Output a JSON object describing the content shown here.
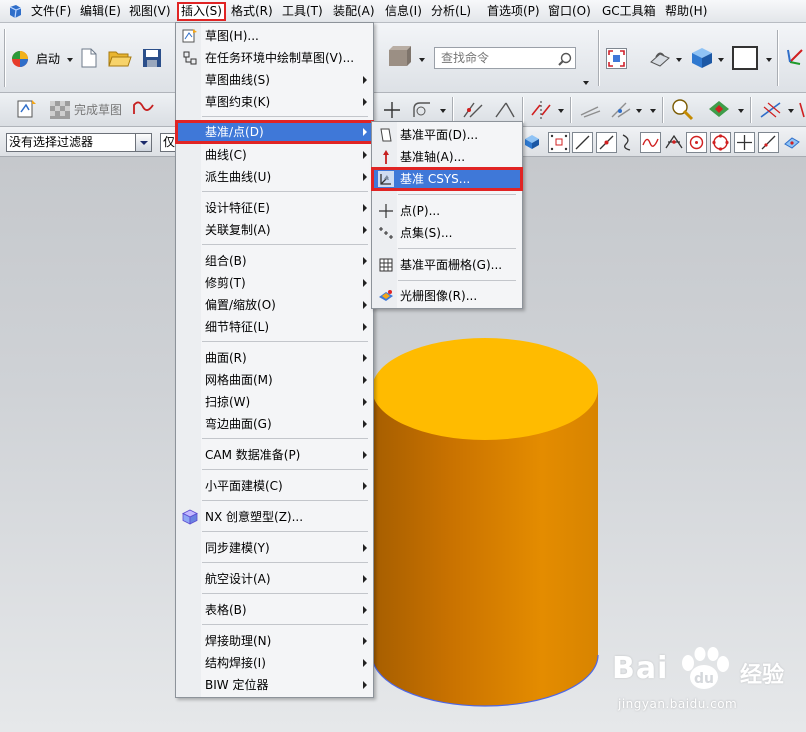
{
  "menubar": {
    "items": [
      "文件(F)",
      "编辑(E)",
      "视图(V)",
      "插入(S)",
      "格式(R)",
      "工具(T)",
      "装配(A)",
      "信息(I)",
      "分析(L)",
      "首选项(P)",
      "窗口(O)",
      "GC工具箱",
      "帮助(H)"
    ],
    "active_index": 3
  },
  "toolbar": {
    "start_label": "启动",
    "search_placeholder": "查找命令",
    "finish_sketch_label": "完成草图",
    "filter_value": "没有选择过滤器",
    "filter2_value": "仅"
  },
  "insert_menu": {
    "items": [
      {
        "label": "草图(H)...",
        "icon": "sketch-icon",
        "submenu": false
      },
      {
        "label": "在任务环境中绘制草图(V)...",
        "icon": "sketch-task-icon",
        "submenu": false
      },
      {
        "label": "草图曲线(S)",
        "submenu": true
      },
      {
        "label": "草图约束(K)",
        "submenu": true
      },
      {
        "label": "基准/点(D)",
        "submenu": true,
        "highlighted": true
      },
      {
        "label": "曲线(C)",
        "submenu": true
      },
      {
        "label": "派生曲线(U)",
        "submenu": true
      },
      {
        "label": "设计特征(E)",
        "submenu": true
      },
      {
        "label": "关联复制(A)",
        "submenu": true
      },
      {
        "label": "组合(B)",
        "submenu": true
      },
      {
        "label": "修剪(T)",
        "submenu": true
      },
      {
        "label": "偏置/缩放(O)",
        "submenu": true
      },
      {
        "label": "细节特征(L)",
        "submenu": true
      },
      {
        "label": "曲面(R)",
        "submenu": true
      },
      {
        "label": "网格曲面(M)",
        "submenu": true
      },
      {
        "label": "扫掠(W)",
        "submenu": true
      },
      {
        "label": "弯边曲面(G)",
        "submenu": true
      },
      {
        "label": "CAM 数据准备(P)",
        "submenu": true
      },
      {
        "label": "小平面建模(C)",
        "submenu": true
      },
      {
        "label": "NX 创意塑型(Z)...",
        "icon": "nx-realize-shape-icon",
        "submenu": false
      },
      {
        "label": "同步建模(Y)",
        "submenu": true
      },
      {
        "label": "航空设计(A)",
        "submenu": true
      },
      {
        "label": "表格(B)",
        "submenu": true
      },
      {
        "label": "焊接助理(N)",
        "submenu": true
      },
      {
        "label": "结构焊接(I)",
        "submenu": true
      },
      {
        "label": "BIW 定位器",
        "submenu": true
      }
    ]
  },
  "datum_submenu": {
    "items": [
      {
        "label": "基准平面(D)...",
        "icon": "datum-plane-icon"
      },
      {
        "label": "基准轴(A)...",
        "icon": "datum-axis-icon"
      },
      {
        "label": "基准 CSYS...",
        "icon": "datum-csys-icon",
        "highlighted": true
      },
      {
        "label": "点(P)...",
        "icon": "point-icon"
      },
      {
        "label": "点集(S)...",
        "icon": "point-set-icon"
      },
      {
        "label": "基准平面栅格(G)...",
        "icon": "datum-plane-grid-icon"
      },
      {
        "label": "光栅图像(R)...",
        "icon": "raster-image-icon"
      }
    ]
  },
  "colors": {
    "highlight": "#3f78d8",
    "callout_red": "#e02424",
    "cylinder_top": "#ffbb00",
    "cylinder_side": "#e08800"
  },
  "watermark": {
    "brand_left": "Bai",
    "brand_right": "经验",
    "url": "jingyan.baidu.com"
  }
}
